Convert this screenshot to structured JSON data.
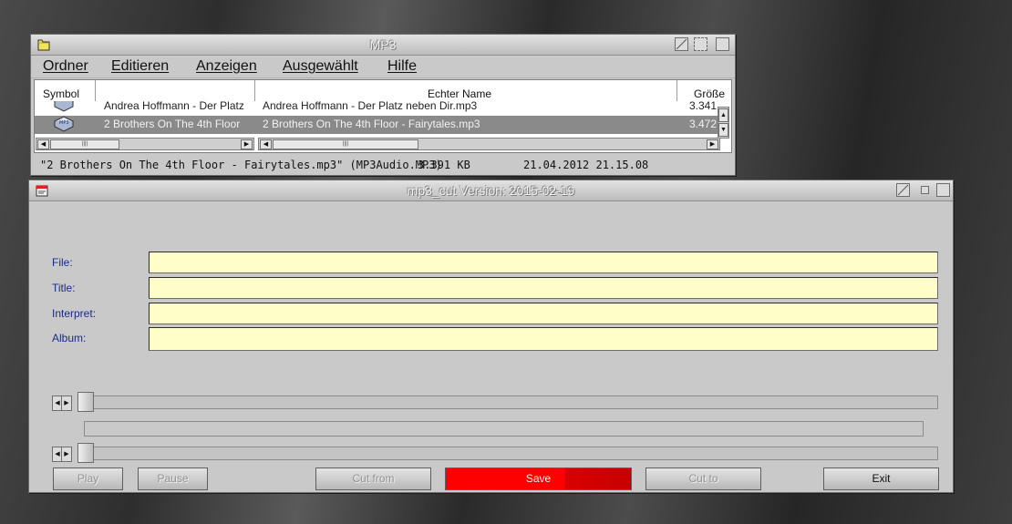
{
  "file_window": {
    "title": "MP3",
    "menu": [
      "Ordner",
      "Editieren",
      "Anzeigen",
      "Ausgewählt",
      "Hilfe"
    ],
    "columns": {
      "symbol": "Symbol",
      "echter_name": "Echter Name",
      "groesse": "Größe"
    },
    "rows": [
      {
        "left_name": "Andrea Hoffmann - Der Platz",
        "real_name": "Andrea Hoffmann - Der Platz neben Dir.mp3",
        "size": "3.341.",
        "selected": false
      },
      {
        "left_name": "2 Brothers On The 4th Floor",
        "real_name": "2 Brothers On The 4th Floor - Fairytales.mp3",
        "size": "3.472.",
        "selected": true
      }
    ],
    "status": {
      "filename": "\"2 Brothers On The 4th Floor - Fairytales.mp3\" (MP3Audio.MP3)",
      "size": "3.391 KB",
      "date": "21.04.2012 21.15.08"
    },
    "icon_names": {
      "folder": "folder-icon",
      "file": "mp3-file-icon"
    }
  },
  "cutter_window": {
    "title": "mp3_cut Version: 2015-02-19",
    "fields": {
      "file": "File:",
      "title": "Title:",
      "interpret": "Interpret:",
      "album": "Album:"
    },
    "buttons": {
      "play": "Play",
      "pause": "Pause",
      "cut_from": "Cut from",
      "save": "Save",
      "cut_to": "Cut to",
      "exit": "Exit"
    },
    "colors": {
      "input_bg": "#fffec8",
      "save_bg": "#ff0000",
      "label": "#1a2a8a"
    }
  }
}
